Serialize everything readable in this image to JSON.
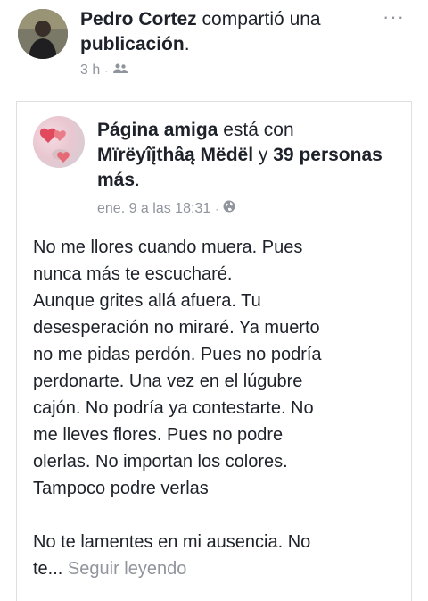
{
  "post": {
    "author": "Pedro Cortez",
    "action_prefix": "compartió una",
    "action_object": "publicación",
    "action_suffix": ".",
    "time": "3 h",
    "separator": "·",
    "audience_icon": "friends-icon",
    "more_icon": "more-icon"
  },
  "shared": {
    "page_name": "Página amiga",
    "with_text": "está con",
    "tagged_name": "Mïrëyîįthâą Mëdël",
    "conj": "y",
    "others": "39 personas más",
    "end_punct": ".",
    "time": "ene. 9 a las 18:31",
    "separator": "·",
    "privacy_icon": "globe-icon",
    "paragraph1": [
      "No me llores cuando muera. Pues",
      "nunca más te escucharé.",
      "Aunque grites allá afuera. Tu",
      "desesperación no miraré. Ya muerto",
      "no me pidas perdón. Pues no podría",
      "perdonarte. Una vez en el lúgubre",
      "cajón. No podría ya contestarte. No",
      "me lleves flores. Pues no podre",
      "olerlas. No importan los colores.",
      "Tampoco podre verlas"
    ],
    "paragraph2_line1": "No te lamentes en mi ausencia. No",
    "paragraph2_line2": "te...",
    "see_more": "Seguir leyendo"
  }
}
